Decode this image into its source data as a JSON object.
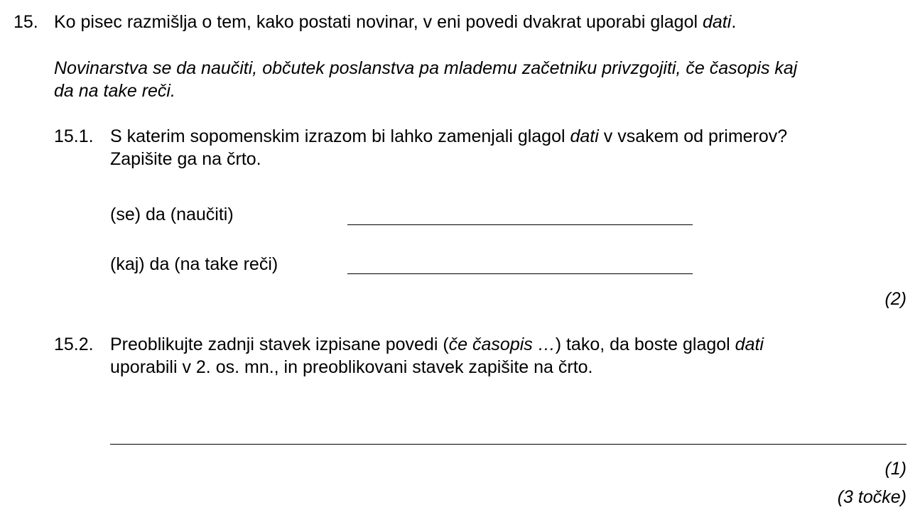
{
  "q15": {
    "number": "15.",
    "intro": {
      "before": "Ko pisec razmišlja o tem, kako postati novinar, v eni povedi dvakrat uporabi glagol ",
      "verb": "dati",
      "after": "."
    },
    "quote_line1": "Novinarstva se da naučiti, občutek poslanstva pa mlademu začetniku privzgojiti, če časopis kaj",
    "quote_line2": "da na take reči."
  },
  "q15_1": {
    "number": "15.1.",
    "line1_before": "S katerim sopomenskim izrazom bi lahko zamenjali glagol ",
    "line1_verb": "dati",
    "line1_after": " v vsakem od primerov?",
    "line2": "Zapišite ga na črto.",
    "item1_label": "(se) da (naučiti)",
    "item2_label": "(kaj) da (na take reči)",
    "points": "(2)"
  },
  "q15_2": {
    "number": "15.2.",
    "line1_a": "Preoblikujte zadnji stavek izpisane povedi (",
    "line1_quote": "če časopis …",
    "line1_b": ") tako, da boste glagol ",
    "line1_verb": "dati",
    "line2": "uporabili v 2. os. mn., in preoblikovani stavek zapišite na črto.",
    "points": "(1)"
  },
  "total_points": "(3 točke)"
}
